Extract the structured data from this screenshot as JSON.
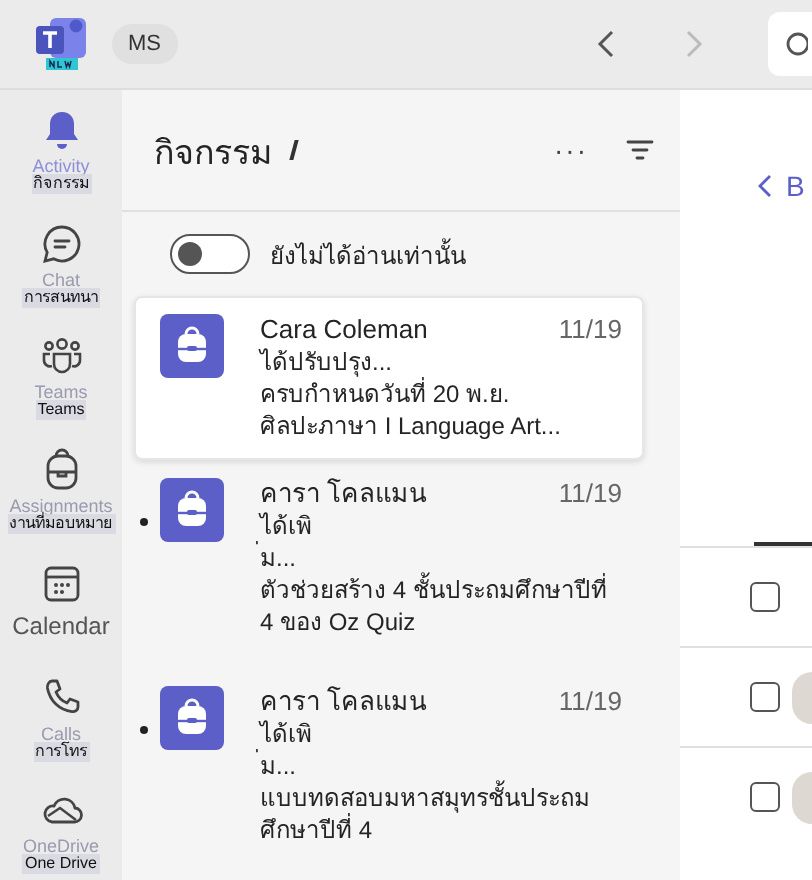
{
  "top_bar": {
    "account": "MS",
    "back_disabled": false,
    "forward_disabled": true
  },
  "rail": [
    {
      "kind": "bell",
      "ghost_label": "Activity",
      "label": "กิจกรรม",
      "selected": true
    },
    {
      "kind": "chat",
      "ghost_label": "Chat",
      "label": "การสนทนา",
      "selected": false
    },
    {
      "kind": "teams",
      "ghost_label": "Teams",
      "label": "Teams",
      "selected": false
    },
    {
      "kind": "backpack",
      "ghost_label": "Assignments",
      "label": "งานที่มอบหมาย",
      "selected": false
    },
    {
      "kind": "calendar",
      "label": "Calendar",
      "selected": false
    },
    {
      "kind": "phone",
      "ghost_label": "Calls",
      "label": "การโทร",
      "selected": false
    },
    {
      "kind": "cloud",
      "ghost_label": "OneDrive",
      "label": "One Drive",
      "selected": false
    }
  ],
  "feed": {
    "title": "กิจกรรม",
    "more": "···",
    "unread_toggle": {
      "label": "ยังไม่ได้อ่านเท่านั้น",
      "on": false
    },
    "items": [
      {
        "sender": "Cara Coleman",
        "date": "11/19",
        "lines": [
          "ได้ปรับปรุง...",
          "ครบกำหนดวันที่ 20 พ.ย.",
          "ศิลปะภาษา I Language Art..."
        ],
        "unread": false,
        "selected": true
      },
      {
        "sender": "คารา โคลแมน",
        "date": "11/19",
        "lines": [
          "ได้เพิ",
          "่ม...",
          "ตัวช่วยสร้าง 4 ชั้นประถมศึกษาปีที่ 4 ของ Oz Quiz"
        ],
        "unread": true,
        "selected": false
      },
      {
        "sender": "คารา โคลแมน",
        "date": "11/19",
        "lines": [
          "ได้เพิ",
          "่ม...",
          "แบบทดสอบมหาสมุทรชั้นประถมศึกษาปีที่ 4"
        ],
        "unread": true,
        "selected": false
      }
    ]
  },
  "detail": {
    "back": "B",
    "rows": [
      {
        "checked": false,
        "avatar": false
      },
      {
        "checked": false,
        "avatar": true
      },
      {
        "checked": false,
        "avatar": true
      }
    ]
  }
}
